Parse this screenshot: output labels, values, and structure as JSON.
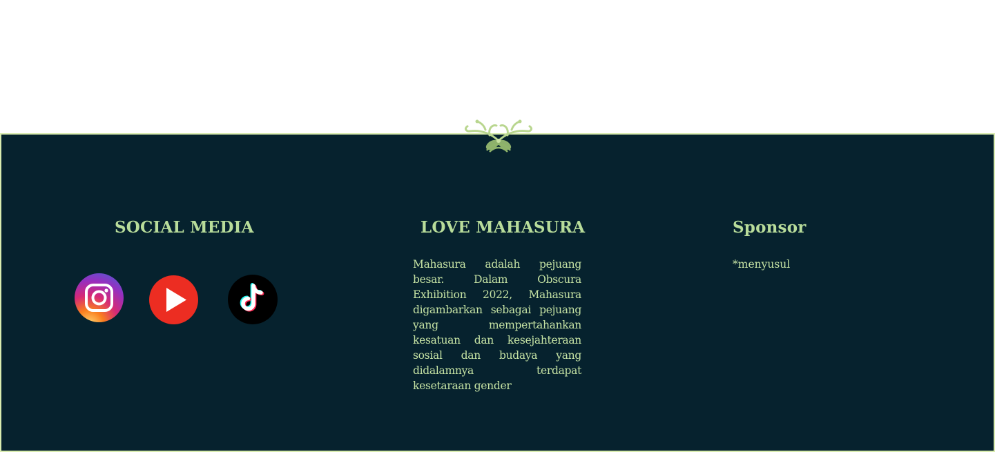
{
  "footer": {
    "social": {
      "title": "SOCIAL MEDIA",
      "icons": [
        {
          "name": "instagram-icon",
          "colors": [
            "#feda75",
            "#fa7e1e",
            "#d62976",
            "#962fbf",
            "#4f5bd5"
          ]
        },
        {
          "name": "youtube-icon",
          "color": "#ec2d22"
        },
        {
          "name": "tiktok-icon",
          "color": "#000000"
        }
      ]
    },
    "love": {
      "title": "LOVE MAHASURA",
      "text": "Mahasura adalah pejuang besar. Dalam Obscura Exhibition 2022, Mahasura digambarkan sebagai pejuang yang mempertahankan kesatuan dan kesejahteraan sosial dan budaya yang didalamnya terdapat kesetaraan gender"
    },
    "sponsor": {
      "title": "Sponsor",
      "text": "*menyusul"
    }
  },
  "colors": {
    "footer_bg": "#06222e",
    "accent": "#b8dc9a",
    "border": "#d9ecb0"
  }
}
